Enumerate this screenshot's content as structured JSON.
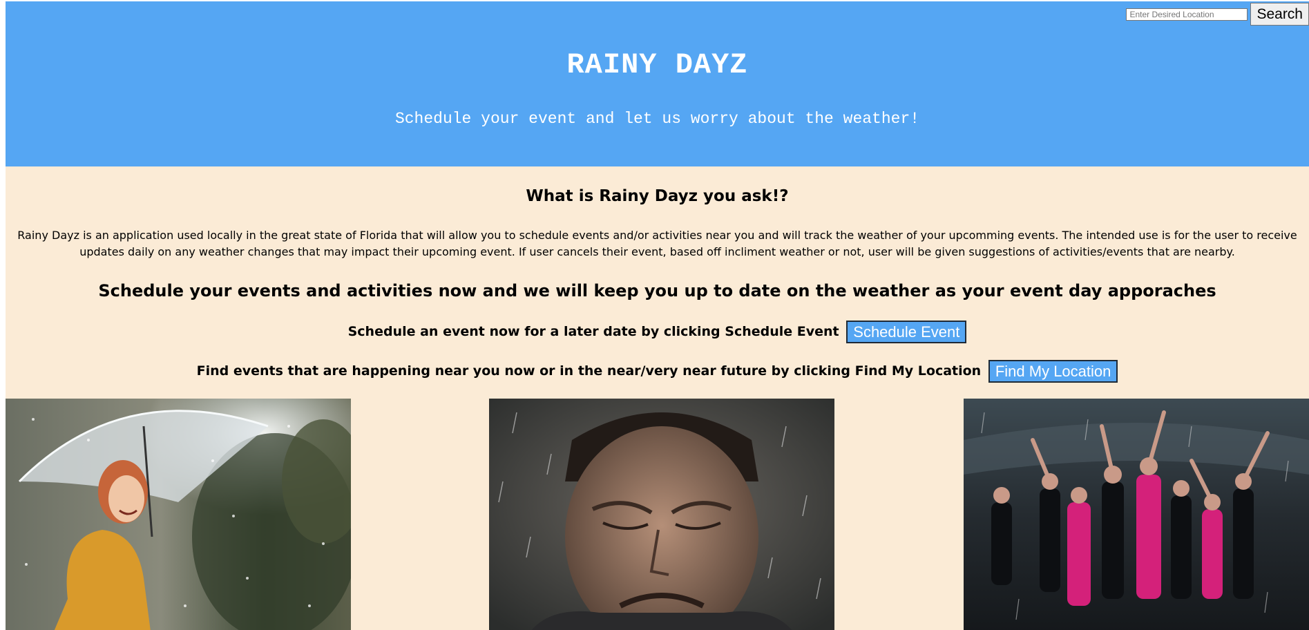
{
  "search": {
    "placeholder": "Enter Desired Location",
    "button_label": "Search"
  },
  "hero": {
    "title": "RAINY DAYZ",
    "subtitle": "Schedule your event and let us worry about the weather!"
  },
  "about": {
    "heading": "What is Rainy Dayz you ask!?",
    "body": "Rainy Dayz is an application used locally in the great state of Florida that will allow you to schedule events and/or activities near you and will track the weather of your upcomming events. The intended use is for the user to receive updates daily on any weather changes that may impact their upcoming event. If user cancels their event, based off incliment weather or not, user will be given suggestions of activities/events that are nearby."
  },
  "tagline": "Schedule your events and activities now and we will keep you up to date on the weather as your event day apporaches",
  "actions": {
    "schedule_text": "Schedule an event now for a later date by clicking Schedule Event",
    "schedule_button": "Schedule Event",
    "location_text": "Find events that are happening near you now or in the near/very near future by clicking Find My Location",
    "location_button": "Find My Location"
  },
  "colors": {
    "hero_background": "#55a6f3",
    "page_background": "#fbebd6",
    "button_background": "#55a6f3"
  },
  "photos": [
    {
      "subject": "smiling woman with transparent umbrella in the rain"
    },
    {
      "subject": "crying man in the rain"
    },
    {
      "subject": "dancers performing in the rain in a stadium"
    }
  ]
}
